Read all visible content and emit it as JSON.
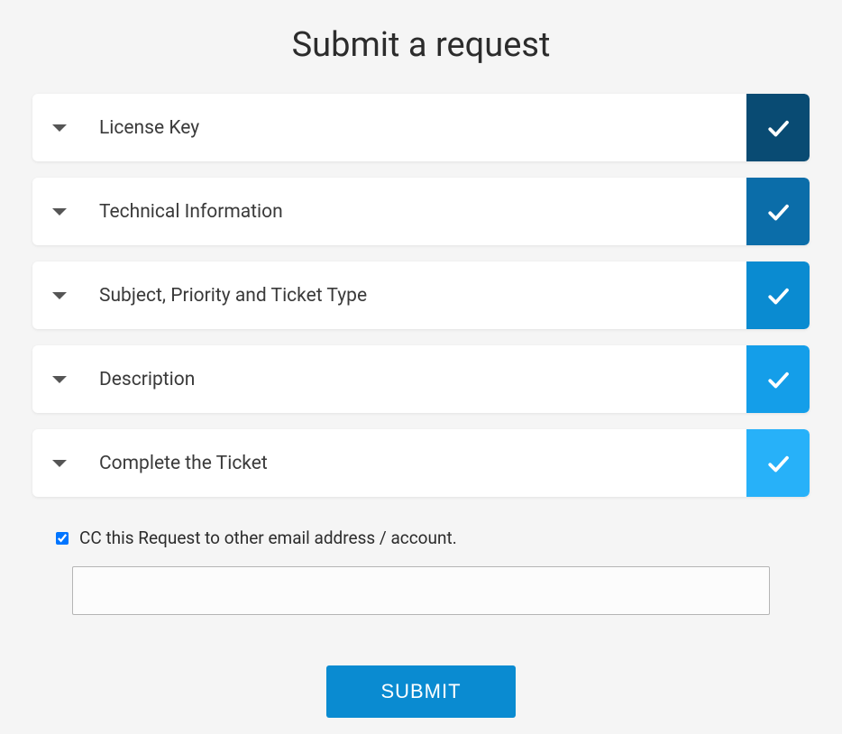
{
  "page_title": "Submit a request",
  "accordion": [
    {
      "label": "License Key",
      "check_color_class": "check-1"
    },
    {
      "label": "Technical Information",
      "check_color_class": "check-2"
    },
    {
      "label": "Subject, Priority and Ticket Type",
      "check_color_class": "check-3"
    },
    {
      "label": "Description",
      "check_color_class": "check-4"
    },
    {
      "label": "Complete the Ticket",
      "check_color_class": "check-5"
    }
  ],
  "cc_section": {
    "checkbox_checked": true,
    "label": "CC this Request to other email address / account.",
    "input_value": ""
  },
  "submit_label": "SUBMIT"
}
